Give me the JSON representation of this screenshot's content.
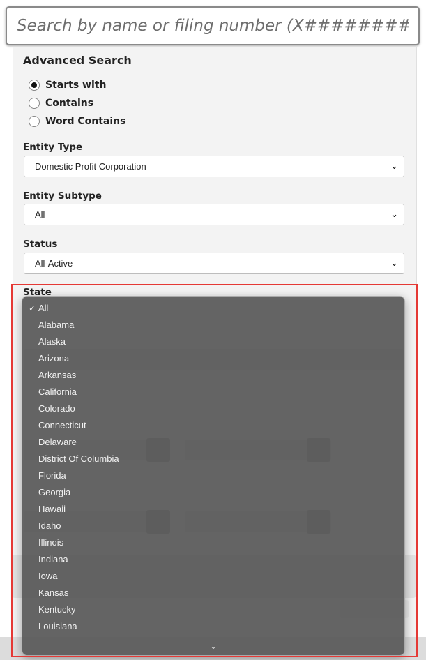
{
  "search": {
    "placeholder": "Search by name or filing number (X########)"
  },
  "advanced": {
    "title": "Advanced Search",
    "radios": [
      {
        "label": "Starts with",
        "checked": true
      },
      {
        "label": "Contains",
        "checked": false
      },
      {
        "label": "Word Contains",
        "checked": false
      }
    ],
    "entity_type": {
      "label": "Entity Type",
      "value": "Domestic Profit Corporation"
    },
    "entity_subtype": {
      "label": "Entity Subtype",
      "value": "All"
    },
    "status": {
      "label": "Status",
      "value": "All-Active"
    },
    "state": {
      "label": "State"
    }
  },
  "state_dropdown": {
    "selected": "All",
    "check_mark": "✓",
    "options": [
      "All",
      "Alabama",
      "Alaska",
      "Arizona",
      "Arkansas",
      "California",
      "Colorado",
      "Connecticut",
      "Delaware",
      "District Of Columbia",
      "Florida",
      "Georgia",
      "Hawaii",
      "Idaho",
      "Illinois",
      "Indiana",
      "Iowa",
      "Kansas",
      "Kentucky",
      "Louisiana"
    ],
    "more_icon": "chevron-down-icon"
  },
  "colors": {
    "highlight": "#e53935",
    "dropdown_bg": "#585858"
  }
}
